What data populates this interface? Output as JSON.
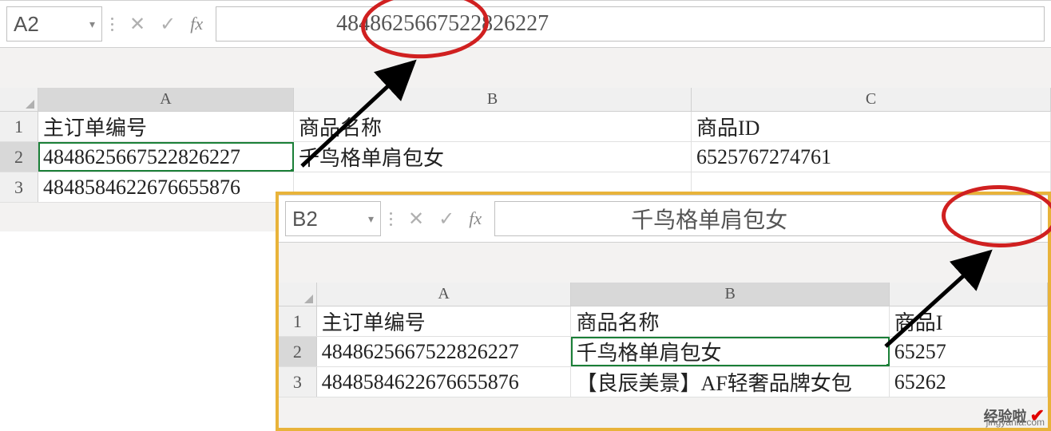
{
  "window1": {
    "name_box": "A2",
    "formula_value": "4848625667522826227",
    "columns": [
      "A",
      "B",
      "C"
    ],
    "rows": [
      {
        "n": "1",
        "A": "主订单编号",
        "B": "商品名称",
        "C": "商品ID"
      },
      {
        "n": "2",
        "A": "4848625667522826227",
        "B": "千鸟格单肩包女",
        "C": "6525767274761"
      },
      {
        "n": "3",
        "A": "4848584622676655876",
        "B": "",
        "C": ""
      }
    ]
  },
  "window2": {
    "name_box": "B2",
    "formula_value": "千鸟格单肩包女",
    "columns": [
      "A",
      "B"
    ],
    "col_c_partial": "",
    "rows": [
      {
        "n": "1",
        "A": "主订单编号",
        "B": "商品名称",
        "C": "商品I"
      },
      {
        "n": "2",
        "A": "4848625667522826227",
        "B": "千鸟格单肩包女",
        "C": "65257"
      },
      {
        "n": "3",
        "A": "4848584622676655876",
        "B": "【良辰美景】AF轻奢品牌女包",
        "C": "65262"
      }
    ]
  },
  "watermark": {
    "zh": "经验啦",
    "en": "jingyanla.com"
  },
  "icons": {
    "check": "✓",
    "cross": "✕",
    "fx": "fx",
    "dd": "▾"
  }
}
